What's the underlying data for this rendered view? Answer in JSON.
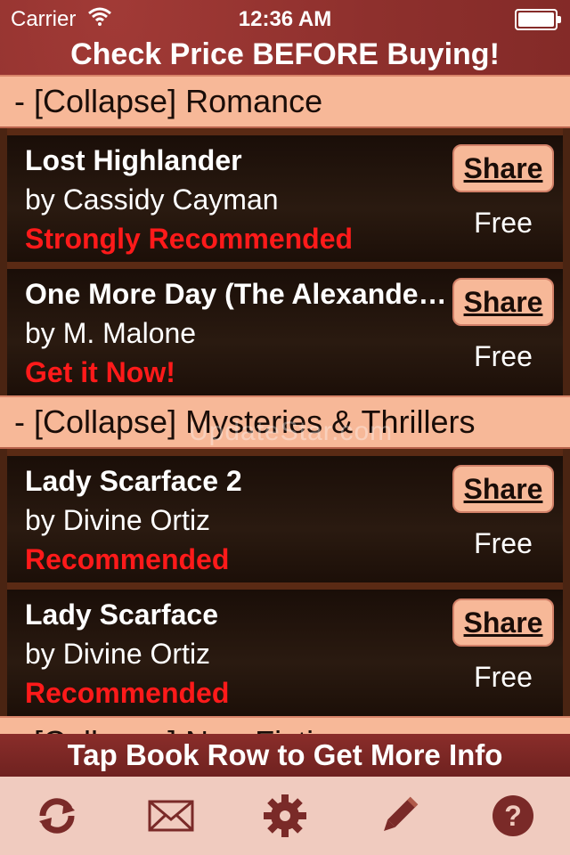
{
  "status": {
    "carrier": "Carrier",
    "time": "12:36 AM"
  },
  "banner": "Check Price BEFORE Buying!",
  "sections": [
    {
      "label": "- [Collapse]  Romance"
    },
    {
      "label": "- [Collapse]  Mysteries & Thrillers"
    },
    {
      "label": "- [Collapse]  Non-Fiction"
    }
  ],
  "books": [
    {
      "title": " Lost Highlander",
      "author": "by Cassidy Cayman",
      "rec": "Strongly Recommended",
      "share": "Share",
      "price": "Free"
    },
    {
      "title": "One More Day (The Alexander Family)",
      "author": "by M. Malone",
      "rec": "Get it Now!",
      "share": "Share",
      "price": "Free"
    },
    {
      "title": "Lady Scarface 2",
      "author": "by Divine Ortiz",
      "rec": "Recommended",
      "share": "Share",
      "price": "Free"
    },
    {
      "title": "Lady Scarface",
      "author": "by Divine Ortiz",
      "rec": "Recommended",
      "share": "Share",
      "price": "Free"
    }
  ],
  "watermark": "UpdateStar.com",
  "footer": "Tap Book Row to Get More Info",
  "tabs": [
    {
      "icon": "refresh-icon"
    },
    {
      "icon": "mail-icon"
    },
    {
      "icon": "gear-icon"
    },
    {
      "icon": "pencil-icon"
    },
    {
      "icon": "help-icon"
    }
  ],
  "colors": {
    "accent": "#f7b898",
    "recommend": "#ff1a1a",
    "icon": "#7a2a28"
  }
}
